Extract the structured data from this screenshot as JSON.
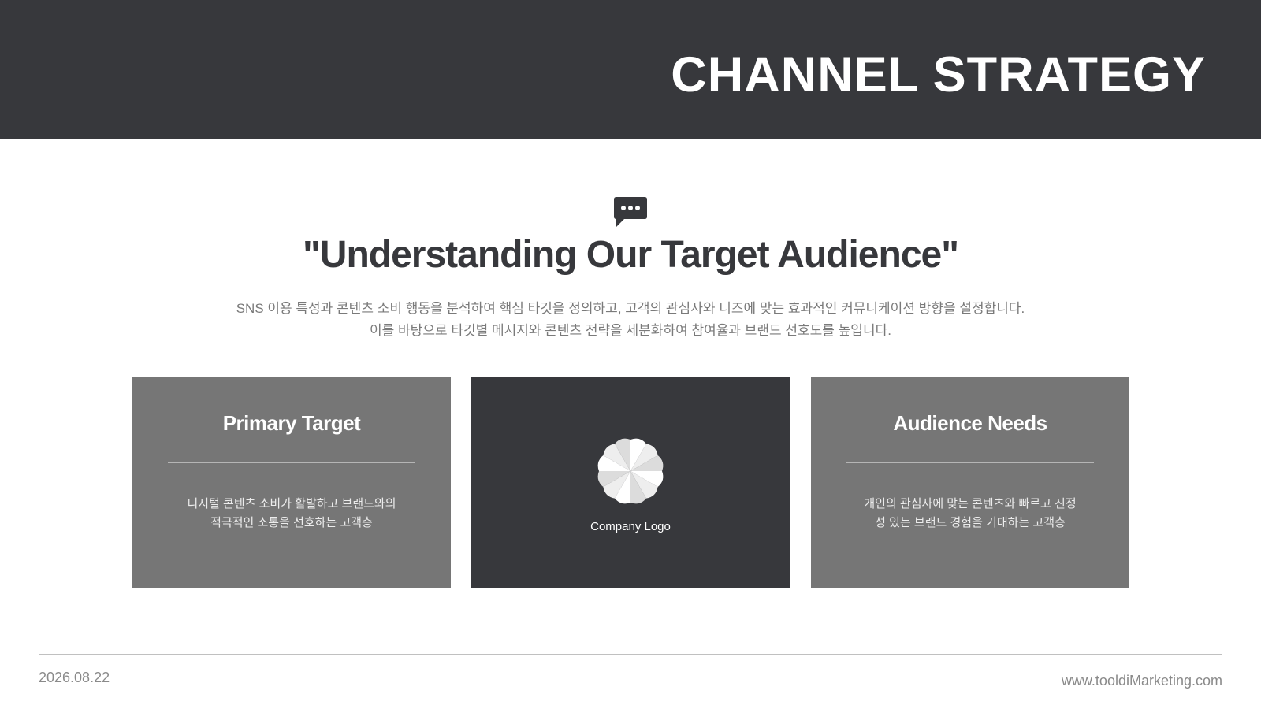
{
  "header": {
    "title": "CHANNEL STRATEGY"
  },
  "intro": {
    "icon": "speech-bubble-icon",
    "title": "\"Understanding Our Target Audience\"",
    "description_line1": "SNS 이용 특성과 콘텐츠 소비 행동을 분석하여 핵심 타깃을 정의하고, 고객의 관심사와 니즈에 맞는 효과적인 커뮤니케이션 방향을 설정합니다.",
    "description_line2": "이를 바탕으로 타깃별 메시지와 콘텐츠 전략을 세분화하여 참여율과 브랜드 선호도를 높입니다."
  },
  "cards": [
    {
      "title": "Primary Target",
      "line1": "디지털 콘텐츠 소비가 활발하고 브랜드와의",
      "line2": "적극적인 소통을 선호하는 고객층"
    },
    {
      "logo_icon": "flower-logo-icon",
      "caption": "Company Logo"
    },
    {
      "title": "Audience Needs",
      "line1": "개인의 관심사에 맞는 콘텐츠와 빠르고 진정",
      "line2": "성 있는 브랜드 경험을 기대하는 고객층"
    }
  ],
  "footer": {
    "date": "2026.08.22",
    "url": "www.tooldiMarketing.com"
  },
  "colors": {
    "header_bg": "#37383c",
    "card_grey": "#767676",
    "card_dark": "#37383c",
    "text_dark": "#37383c",
    "text_muted": "#7a7a7a"
  }
}
